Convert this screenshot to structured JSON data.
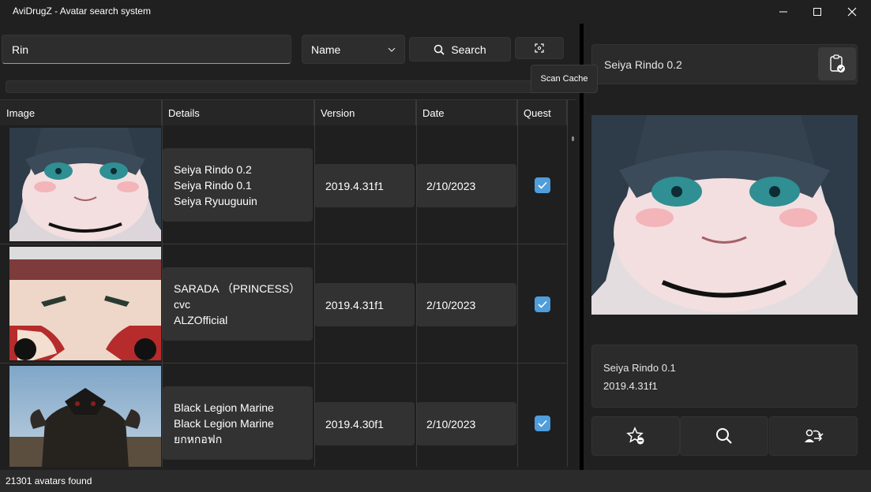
{
  "window": {
    "title": "AviDrugZ - Avatar search system",
    "controls": [
      "minimize-icon",
      "maximize-icon",
      "close-icon"
    ]
  },
  "search": {
    "query": "Rin",
    "mode_selected": "Name",
    "search_label": "Search",
    "scan_tooltip": "Scan Cache"
  },
  "grid": {
    "columns": [
      "Image",
      "Details",
      "Version",
      "Date",
      "Quest"
    ],
    "rows": [
      {
        "thumbnail": "anime-girl-face",
        "details": [
          "Seiya Rindo 0.2",
          "Seiya Rindo 0.1",
          "Seiya Ryuuguuin"
        ],
        "version": "2019.4.31f1",
        "date": "2/10/2023",
        "quest": true
      },
      {
        "thumbnail": "red-hat-character",
        "details": [
          "SARADA （PRINCESS）",
          "cvc",
          "ALZOfficial"
        ],
        "version": "2019.4.31f1",
        "date": "2/10/2023",
        "quest": true
      },
      {
        "thumbnail": "armored-marine",
        "details": [
          "Black Legion Marine",
          "Black Legion Marine",
          "ยกหกอฟก"
        ],
        "version": "2019.4.30f1",
        "date": "2/10/2023",
        "quest": true
      }
    ]
  },
  "status": "21301 avatars found",
  "selected": {
    "name": "Seiya Rindo 0.2",
    "description": "Seiya Rindo 0.1",
    "unity_version": "2019.4.31f1",
    "actions": [
      "favorite-add-icon",
      "search-icon",
      "user-switch-icon"
    ]
  },
  "colors": {
    "background": "#202020",
    "panel": "#2b2b2b",
    "cell": "#323232",
    "accent": "#4f9ddb"
  }
}
